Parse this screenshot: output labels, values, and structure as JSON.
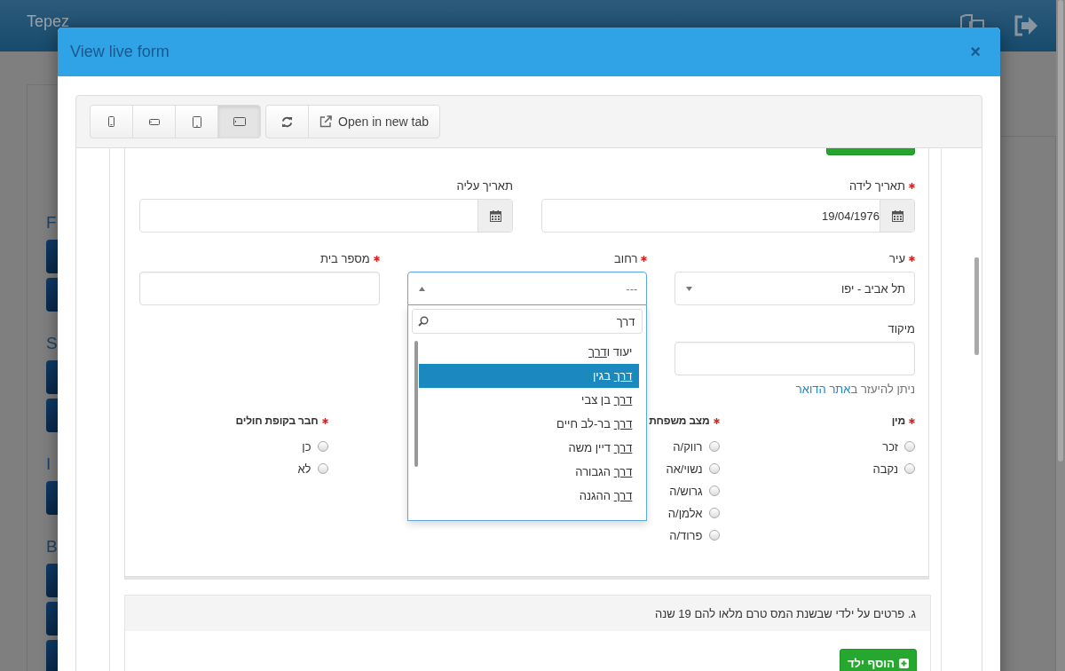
{
  "app": {
    "brand": "Tepez",
    "sidebar_labels": [
      "F",
      "S",
      "I",
      "B"
    ]
  },
  "modal": {
    "title": "View live form",
    "close": "×",
    "toolbar": {
      "devices": [
        {
          "kind": "phone",
          "selected": false
        },
        {
          "kind": "phone-landscape",
          "selected": false
        },
        {
          "kind": "tablet",
          "selected": false
        },
        {
          "kind": "tablet-landscape",
          "selected": true
        }
      ],
      "open_tab": "Open in new tab"
    },
    "dates": [
      {
        "label": "תאריך לידה",
        "required": true,
        "value": "19/04/1976"
      },
      {
        "label": "תאריך עליה",
        "required": false
      }
    ],
    "address": [
      {
        "label": "עיר",
        "required": true,
        "kind": "select",
        "value": "תל אביב - יפו"
      },
      {
        "label": "רחוב",
        "required": true,
        "kind": "select-open",
        "placeholder": "---"
      },
      {
        "label": "מספר בית",
        "required": true,
        "kind": "text"
      }
    ],
    "zip": {
      "label": "מיקוד",
      "help": "ניתן להיעזר ב",
      "help_link": "אתר הדואר"
    },
    "radio_groups": [
      {
        "label": "מין",
        "required": true,
        "options": [
          {
            "label": "זכר",
            "selected": false
          },
          {
            "label": "נקבה",
            "selected": false
          }
        ]
      },
      {
        "label": "מצב משפחת",
        "required": true,
        "options": [
          {
            "label": "רווק/ה",
            "selected": false
          },
          {
            "label": "נשוי/אה",
            "selected": false
          },
          {
            "label": "גרוש/ה",
            "selected": false
          },
          {
            "label": "אלמן/ה",
            "selected": false
          },
          {
            "label": "פרוד/ה",
            "selected": false
          }
        ]
      },
      {
        "label": "חבר בקופת חולים",
        "required": true,
        "options": [
          {
            "label": "כן",
            "selected": false
          },
          {
            "label": "לא",
            "selected": false
          }
        ]
      }
    ],
    "dropdown": {
      "search": "דרך",
      "options": [
        {
          "before": "יעוד ו",
          "match": "דרך",
          "selected": false
        },
        {
          "match": "דרך",
          "after": " בגין",
          "selected": true
        },
        {
          "match": "דרך",
          "after": " בן צבי",
          "selected": false
        },
        {
          "match": "דרך",
          "after": " בר-לב חיים",
          "selected": false
        },
        {
          "match": "דרך",
          "after": " דיין משה",
          "selected": false
        },
        {
          "match": "דרך",
          "after": " הגבורה",
          "selected": false
        },
        {
          "match": "דרך",
          "after": " ההגנה",
          "selected": false
        }
      ]
    },
    "section": {
      "title": "ג. פרטים על ילדי שבשנת המס טרם מלאו להם 19 שנה",
      "button": "הוסף ילד"
    }
  }
}
